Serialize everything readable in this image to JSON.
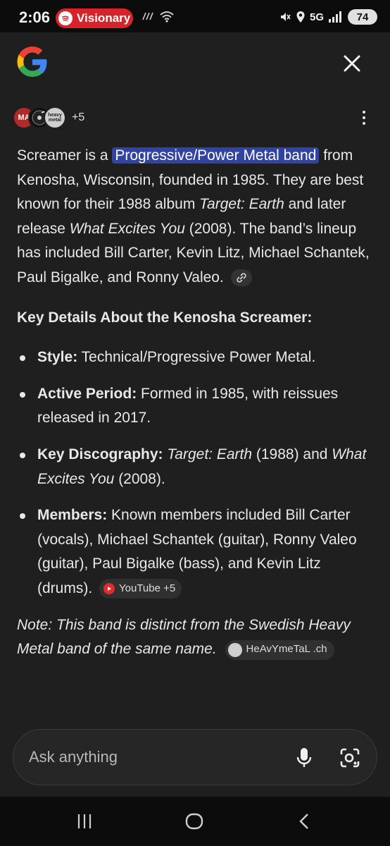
{
  "status_bar": {
    "time": "2:06",
    "spotify_label": "Visionary",
    "network": "5G",
    "battery": "74"
  },
  "header": {
    "logo": "google-logo",
    "close_icon": "close-icon"
  },
  "sources": {
    "avatar_1": "MA",
    "avatar_3": "heavy metal",
    "more_count": "+5"
  },
  "answer": {
    "intro_pre": "Screamer is a ",
    "intro_highlight": "Progressive/Power Metal band",
    "intro_mid": " from Kenosha, Wisconsin, founded in 1985. They are best known for their 1988 album ",
    "album_1": "Target: Earth",
    "intro_mid2": " and later release ",
    "album_2": "What Excites You",
    "intro_post": " (2008). The band’s lineup has included Bill Carter, Kevin Litz, Michael Schantek, Paul Bigalke, and Ronny Valeo.",
    "heading": "Key Details About the Kenosha Screamer:",
    "details": [
      {
        "label": "Style:",
        "text": " Technical/Progressive Power Metal."
      },
      {
        "label": "Active Period:",
        "text": " Formed in 1985, with reissues released in 2017."
      },
      {
        "label": "Key Discography:",
        "text_album_1": "Target: Earth",
        "text_mid": " (1988) and ",
        "text_album_2": "What Excites You",
        "text_post": " (2008)."
      },
      {
        "label": "Members:",
        "text": " Known members included Bill Carter (vocals), Michael Schantek (guitar), Ronny Valeo (guitar), Paul Bigalke (bass), and Kevin Litz (drums).",
        "chip": "YouTube +5"
      }
    ],
    "note": "Note: This band is distinct from the Swedish Heavy Metal band of the same name.",
    "note_chip": "HeAvYmeTaL .ch"
  },
  "ask_bar": {
    "placeholder": "Ask anything"
  },
  "colors": {
    "highlight": "#3143a3",
    "background": "#1f1f1f",
    "spotify": "#d6242a",
    "youtube": "#e22b2b"
  }
}
